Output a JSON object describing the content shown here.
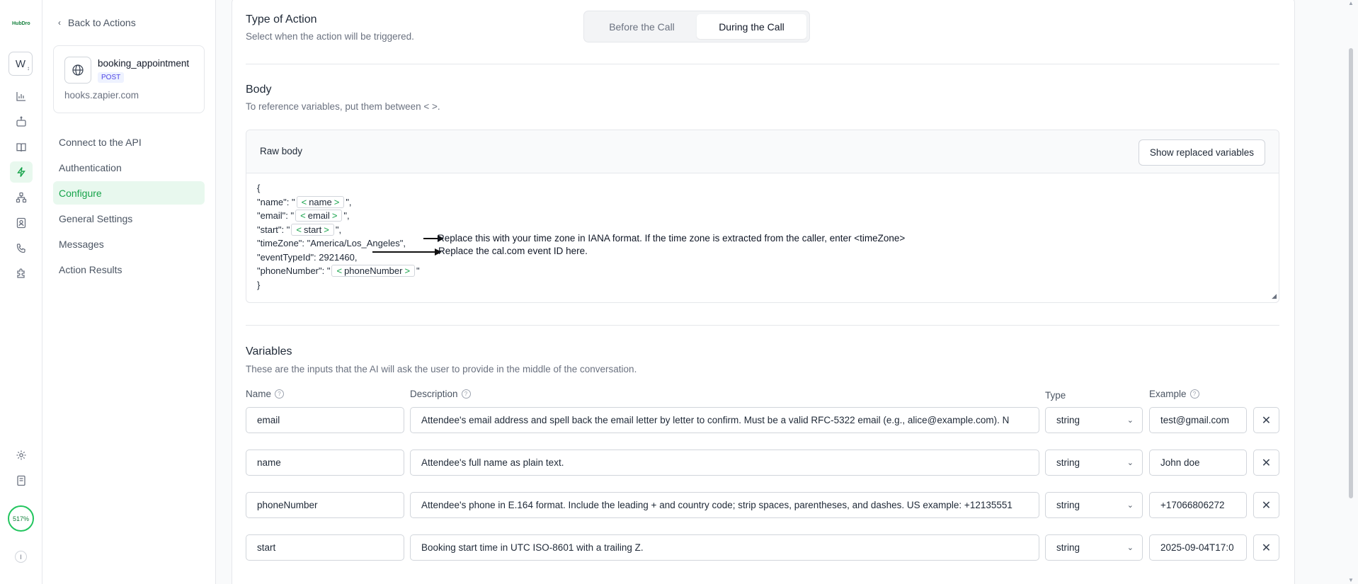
{
  "rail": {
    "logo": "HubDro",
    "workspace_initial": "W",
    "usage": "517%",
    "bottom_badge": "I"
  },
  "sidebar": {
    "back_label": "Back to Actions",
    "action": {
      "name": "booking_appointment",
      "method": "POST",
      "host": "hooks.zapier.com"
    },
    "items": [
      {
        "label": "Connect to the API"
      },
      {
        "label": "Authentication"
      },
      {
        "label": "Configure"
      },
      {
        "label": "General Settings"
      },
      {
        "label": "Messages"
      },
      {
        "label": "Action Results"
      }
    ],
    "active_item": "Configure",
    "accent_color": "#16a34a"
  },
  "type_of_action": {
    "title": "Type of Action",
    "subtitle": "Select when the action will be triggered.",
    "options": [
      "Before the Call",
      "During the Call"
    ],
    "selected": "During the Call"
  },
  "body": {
    "title": "Body",
    "subtitle": "To reference variables, put them between < >.",
    "raw_label": "Raw body",
    "show_button": "Show replaced variables",
    "code": {
      "open": "{",
      "name_key": "\"name\": \"",
      "name_var": "name",
      "email_key": "\"email\": \"",
      "email_var": "email",
      "start_key": "\"start\": \"",
      "start_var": "start",
      "quote_comma": "\",",
      "quote": "\"",
      "timezone_line": "\"timeZone\": \"America/Los_Angeles\",",
      "eventtype_line": "\"eventTypeId\": 2921460,",
      "phone_key": "\"phoneNumber\": \"",
      "phone_var": "phoneNumber",
      "close": "}",
      "lt": "<",
      "gt": ">"
    },
    "annotations": {
      "timezone": "Replace this with your time zone in IANA format. If the time zone is extracted from the caller, enter <timeZone>",
      "event_id": "Replace the cal.com event ID here."
    }
  },
  "variables": {
    "title": "Variables",
    "subtitle": "These are the inputs that the AI will ask the user to provide in the middle of the conversation.",
    "columns": {
      "name": "Name",
      "description": "Description",
      "type": "Type",
      "example": "Example"
    },
    "rows": [
      {
        "name": "email",
        "description": "Attendee's email address and spell back the email letter by letter to confirm. Must be a valid RFC-5322 email (e.g., alice@example.com). N",
        "type": "string",
        "example": "test@gmail.com"
      },
      {
        "name": "name",
        "description": "Attendee's full name as plain text.",
        "type": "string",
        "example": "John doe"
      },
      {
        "name": "phoneNumber",
        "description": "Attendee's phone in E.164 format. Include the leading + and country code; strip spaces, parentheses, and dashes.  US example: +12135551",
        "type": "string",
        "example": "+17066806272"
      },
      {
        "name": "start",
        "description": "Booking start time in UTC ISO-8601 with a trailing Z.",
        "type": "string",
        "example": "2025-09-04T17:0"
      }
    ]
  },
  "icons": [
    "chevron-left-icon",
    "globe-icon",
    "bar-chart-icon",
    "robot-icon",
    "book-icon",
    "lightning-icon",
    "workflow-icon",
    "contact-icon",
    "phone-icon",
    "puzzle-icon",
    "gear-icon",
    "docs-icon",
    "help-icon",
    "chevron-down-icon",
    "close-icon",
    "arrow-right-icon"
  ]
}
